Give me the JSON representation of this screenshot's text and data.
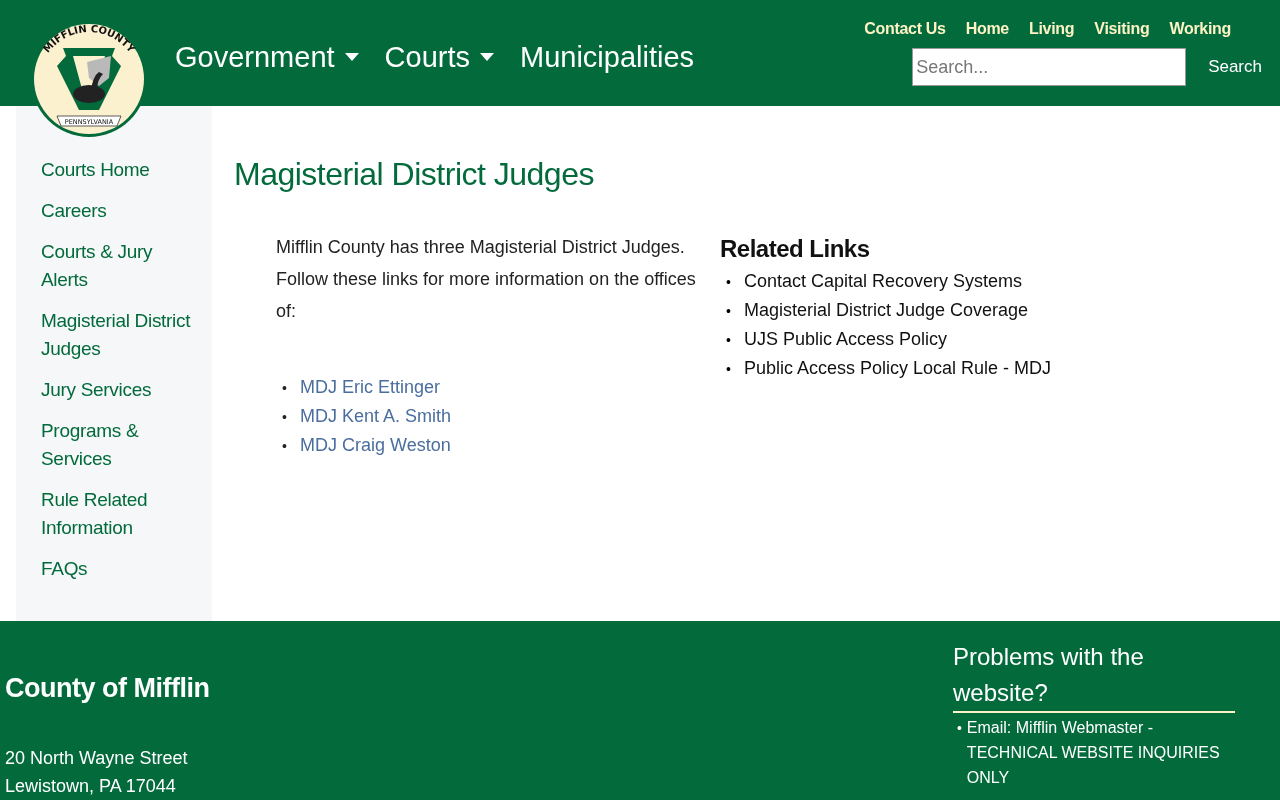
{
  "header": {
    "logo": {
      "top_text": "MIFFLIN COUNTY",
      "banner_text": "PENNSYLVANIA"
    },
    "main_nav": [
      {
        "label": "Government",
        "dropdown": true
      },
      {
        "label": "Courts",
        "dropdown": true
      },
      {
        "label": "Municipalities",
        "dropdown": false
      }
    ],
    "top_links": [
      "Contact Us",
      "Home",
      "Living",
      "Visiting",
      "Working"
    ],
    "search": {
      "placeholder": "Search...",
      "button": "Search"
    }
  },
  "sidebar": {
    "items": [
      "Courts Home",
      "Careers",
      "Courts & Jury Alerts",
      "Magisterial District Judges",
      "Jury Services",
      "Programs & Services",
      "Rule Related Information",
      "FAQs"
    ]
  },
  "main": {
    "title": "Magisterial District Judges",
    "intro": "Mifflin County has three Magisterial District Judges.  Follow these links for more information on the offices of:",
    "judge_links": [
      {
        "bullet": "•",
        "label": "MDJ Eric Ettinger"
      },
      {
        "bullet": "•",
        "label": "MDJ Kent A. Smith"
      },
      {
        "bullet": "•",
        "label": "MDJ Craig Weston"
      }
    ],
    "related": {
      "title": "Related Links",
      "items": [
        {
          "bullet": "•",
          "label": "Contact Capital Recovery Systems"
        },
        {
          "bullet": "•",
          "label": "Magisterial District Judge Coverage"
        },
        {
          "bullet": "•",
          "label": "UJS Public Access Policy"
        },
        {
          "bullet": "•",
          "label": "Public Access Policy Local Rule - MDJ"
        }
      ]
    }
  },
  "footer": {
    "title": "County of Mifflin",
    "address": [
      "20 North Wayne Street",
      "Lewistown, PA 17044"
    ],
    "problems": {
      "title": "Problems with the website?",
      "items": [
        {
          "bullet": "•",
          "label": "Email: Mifflin Webmaster - TECHNICAL WEBSITE INQUIRIES ONLY"
        }
      ]
    }
  }
}
